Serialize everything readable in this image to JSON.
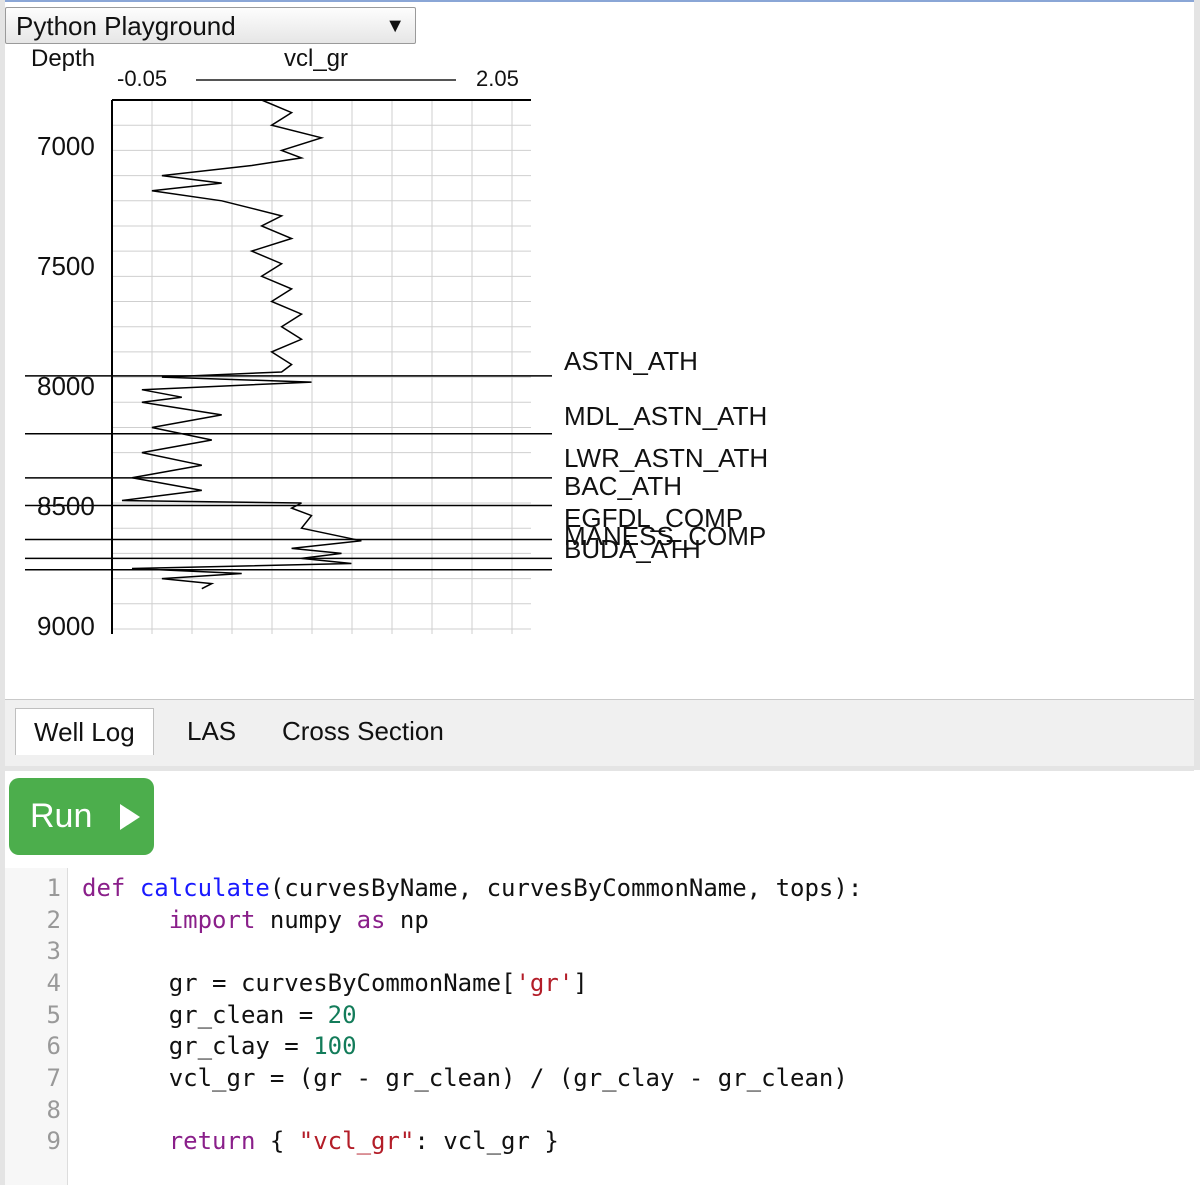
{
  "app": {
    "selector_value": "Python Playground",
    "selector_arrow": "▼"
  },
  "well_log": {
    "depth_title": "Depth",
    "curve_name": "vcl_gr",
    "x_min_label": "-0.05",
    "x_max_label": "2.05",
    "y_ticks": [
      "7000",
      "7500",
      "8000",
      "8500",
      "9000"
    ],
    "tops": [
      {
        "name": "ASTN_ATH",
        "depth": 7895
      },
      {
        "name": "MDL_ASTN_ATH",
        "depth": 8125
      },
      {
        "name": "LWR_ASTN_ATH",
        "depth": 8300
      },
      {
        "name": "BAC_ATH",
        "depth": 8410
      },
      {
        "name": "EGFDL_COMP",
        "depth": 8545
      },
      {
        "name": "MANESS_COMP",
        "depth": 8620
      },
      {
        "name": "BUDA_ATH",
        "depth": 8665
      }
    ]
  },
  "chart_data": {
    "type": "line",
    "title": "vcl_gr",
    "ylabel": "Depth",
    "xlim": [
      -0.05,
      2.05
    ],
    "ylim": [
      8920,
      6800
    ],
    "x_ticks": [
      "-0.05",
      "2.05"
    ],
    "y_ticks": [
      7000,
      7500,
      8000,
      8500,
      9000
    ],
    "grid": true,
    "series": [
      {
        "name": "vcl_gr",
        "depth": [
          6800,
          6850,
          6900,
          6950,
          7000,
          7030,
          7060,
          7100,
          7130,
          7160,
          7200,
          7230,
          7260,
          7300,
          7350,
          7400,
          7450,
          7500,
          7550,
          7600,
          7650,
          7700,
          7750,
          7800,
          7850,
          7880,
          7900,
          7920,
          7950,
          7980,
          8000,
          8050,
          8100,
          8150,
          8200,
          8250,
          8300,
          8350,
          8390,
          8400,
          8420,
          8450,
          8500,
          8550,
          8580,
          8600,
          8620,
          8640,
          8660,
          8680,
          8700,
          8720,
          8740
        ],
        "values": [
          0.7,
          0.85,
          0.75,
          1.0,
          0.8,
          0.9,
          0.65,
          0.2,
          0.5,
          0.15,
          0.5,
          0.65,
          0.8,
          0.7,
          0.85,
          0.65,
          0.8,
          0.7,
          0.85,
          0.75,
          0.9,
          0.8,
          0.9,
          0.75,
          0.85,
          0.8,
          0.2,
          0.95,
          0.1,
          0.3,
          0.1,
          0.5,
          0.15,
          0.45,
          0.1,
          0.4,
          0.05,
          0.4,
          0.0,
          0.9,
          0.85,
          0.95,
          0.9,
          1.2,
          0.85,
          1.1,
          0.9,
          1.15,
          0.05,
          0.6,
          0.2,
          0.45,
          0.4
        ]
      }
    ]
  },
  "tabs": {
    "well_log": "Well Log",
    "las": "LAS",
    "cross_section": "Cross Section"
  },
  "run_button": {
    "label": "Run"
  },
  "editor": {
    "line_numbers": [
      "1",
      "2",
      "3",
      "4",
      "5",
      "6",
      "7",
      "8",
      "9"
    ],
    "lines": [
      {
        "t1": "def",
        "t2": " ",
        "t3": "calculate",
        "t4": "(curvesByName, curvesByCommonName, tops):"
      },
      {
        "t1": "      ",
        "t2": "import",
        "t3": " numpy ",
        "t4": "as",
        "t5": " np"
      },
      {},
      {
        "t1": "      gr = curvesByCommonName[",
        "t2": "'gr'",
        "t3": "]"
      },
      {
        "t1": "      gr_clean = ",
        "t2": "20"
      },
      {
        "t1": "      gr_clay = ",
        "t2": "100"
      },
      {
        "t1": "      vcl_gr = (gr - gr_clean) / (gr_clay - gr_clean)"
      },
      {},
      {
        "t1": "      ",
        "t2": "return",
        "t3": " { ",
        "t4": "\"vcl_gr\"",
        "t5": ": vcl_gr }"
      }
    ]
  }
}
